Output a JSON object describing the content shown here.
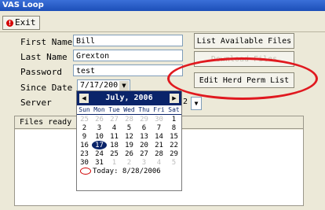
{
  "window": {
    "title": "VAS Loop"
  },
  "toolbar": {
    "exit_label": "Exit"
  },
  "form": {
    "first_name_label": "First Name",
    "first_name_value": "Bill",
    "last_name_label": "Last Name",
    "last_name_value": "Grexton",
    "password_label": "Password",
    "password_value": "test",
    "since_date_label": "Since Date",
    "since_date_value": "7/17/200",
    "server_label": "Server",
    "server_value_tail": "2"
  },
  "buttons": {
    "list_available": "List Available Files",
    "download": "Download Files",
    "edit_herd": "Edit Herd Perm List"
  },
  "files": {
    "status": "Files ready"
  },
  "calendar": {
    "month_title": "July, 2006",
    "weekdays": [
      "Sun",
      "Mon",
      "Tue",
      "Wed",
      "Thu",
      "Fri",
      "Sat"
    ],
    "weeks": [
      [
        {
          "d": "25",
          "o": true
        },
        {
          "d": "26",
          "o": true
        },
        {
          "d": "27",
          "o": true
        },
        {
          "d": "28",
          "o": true
        },
        {
          "d": "29",
          "o": true
        },
        {
          "d": "30",
          "o": true
        },
        {
          "d": "1"
        }
      ],
      [
        {
          "d": "2"
        },
        {
          "d": "3"
        },
        {
          "d": "4"
        },
        {
          "d": "5"
        },
        {
          "d": "6"
        },
        {
          "d": "7"
        },
        {
          "d": "8"
        }
      ],
      [
        {
          "d": "9"
        },
        {
          "d": "10"
        },
        {
          "d": "11"
        },
        {
          "d": "12"
        },
        {
          "d": "13"
        },
        {
          "d": "14"
        },
        {
          "d": "15"
        }
      ],
      [
        {
          "d": "16"
        },
        {
          "d": "17",
          "sel": true
        },
        {
          "d": "18"
        },
        {
          "d": "19"
        },
        {
          "d": "20"
        },
        {
          "d": "21"
        },
        {
          "d": "22"
        }
      ],
      [
        {
          "d": "23"
        },
        {
          "d": "24"
        },
        {
          "d": "25"
        },
        {
          "d": "26"
        },
        {
          "d": "27"
        },
        {
          "d": "28"
        },
        {
          "d": "29"
        }
      ],
      [
        {
          "d": "30"
        },
        {
          "d": "31"
        },
        {
          "d": "1",
          "o": true
        },
        {
          "d": "2",
          "o": true
        },
        {
          "d": "3",
          "o": true
        },
        {
          "d": "4",
          "o": true
        },
        {
          "d": "5",
          "o": true
        }
      ]
    ],
    "today_label": "Today: 8/28/2006"
  }
}
